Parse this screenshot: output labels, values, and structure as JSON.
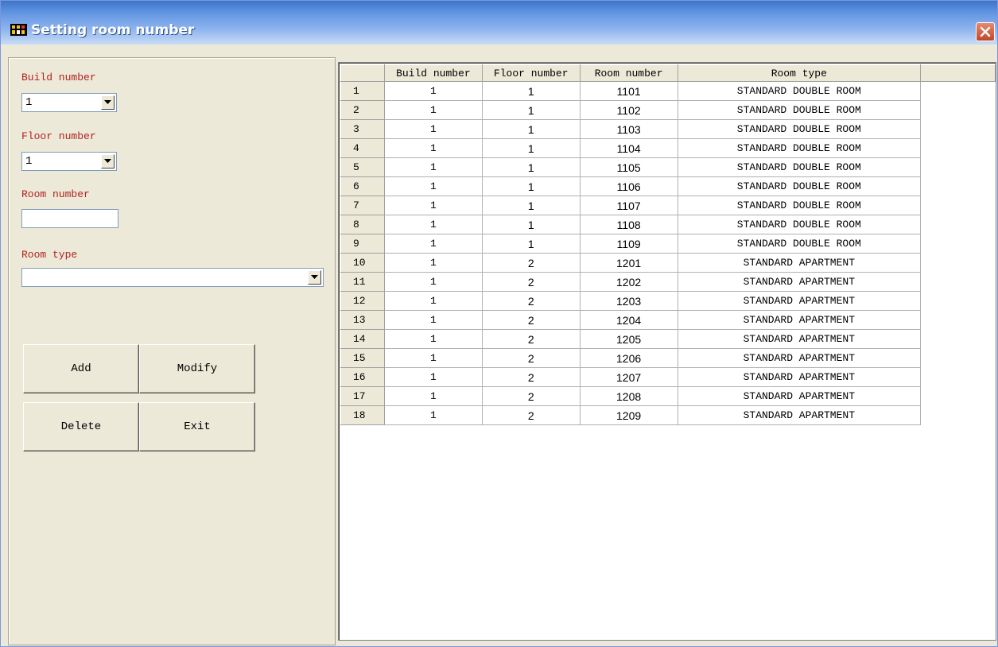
{
  "window": {
    "title": "Setting room number"
  },
  "form": {
    "build_label": "Build number",
    "build_value": "1",
    "floor_label": "Floor number",
    "floor_value": "1",
    "room_label": "Room number",
    "room_value": "",
    "type_label": "Room type",
    "type_value": ""
  },
  "buttons": {
    "add": "Add",
    "modify": "Modify",
    "delete": "Delete",
    "exit": "Exit"
  },
  "grid": {
    "columns": [
      "Build number",
      "Floor number",
      "Room number",
      "Room type"
    ],
    "rows": [
      {
        "n": "1",
        "build": "1",
        "floor": "1",
        "room": "1101",
        "type": "STANDARD DOUBLE ROOM"
      },
      {
        "n": "2",
        "build": "1",
        "floor": "1",
        "room": "1102",
        "type": "STANDARD DOUBLE ROOM"
      },
      {
        "n": "3",
        "build": "1",
        "floor": "1",
        "room": "1103",
        "type": "STANDARD DOUBLE ROOM"
      },
      {
        "n": "4",
        "build": "1",
        "floor": "1",
        "room": "1104",
        "type": "STANDARD DOUBLE ROOM"
      },
      {
        "n": "5",
        "build": "1",
        "floor": "1",
        "room": "1105",
        "type": "STANDARD DOUBLE ROOM"
      },
      {
        "n": "6",
        "build": "1",
        "floor": "1",
        "room": "1106",
        "type": "STANDARD DOUBLE ROOM"
      },
      {
        "n": "7",
        "build": "1",
        "floor": "1",
        "room": "1107",
        "type": "STANDARD DOUBLE ROOM"
      },
      {
        "n": "8",
        "build": "1",
        "floor": "1",
        "room": "1108",
        "type": "STANDARD DOUBLE ROOM"
      },
      {
        "n": "9",
        "build": "1",
        "floor": "1",
        "room": "1109",
        "type": "STANDARD DOUBLE ROOM"
      },
      {
        "n": "10",
        "build": "1",
        "floor": "2",
        "room": "1201",
        "type": "STANDARD APARTMENT"
      },
      {
        "n": "11",
        "build": "1",
        "floor": "2",
        "room": "1202",
        "type": "STANDARD APARTMENT"
      },
      {
        "n": "12",
        "build": "1",
        "floor": "2",
        "room": "1203",
        "type": "STANDARD APARTMENT"
      },
      {
        "n": "13",
        "build": "1",
        "floor": "2",
        "room": "1204",
        "type": "STANDARD APARTMENT"
      },
      {
        "n": "14",
        "build": "1",
        "floor": "2",
        "room": "1205",
        "type": "STANDARD APARTMENT"
      },
      {
        "n": "15",
        "build": "1",
        "floor": "2",
        "room": "1206",
        "type": "STANDARD APARTMENT"
      },
      {
        "n": "16",
        "build": "1",
        "floor": "2",
        "room": "1207",
        "type": "STANDARD APARTMENT"
      },
      {
        "n": "17",
        "build": "1",
        "floor": "2",
        "room": "1208",
        "type": "STANDARD APARTMENT"
      },
      {
        "n": "18",
        "build": "1",
        "floor": "2",
        "room": "1209",
        "type": "STANDARD APARTMENT"
      }
    ]
  }
}
